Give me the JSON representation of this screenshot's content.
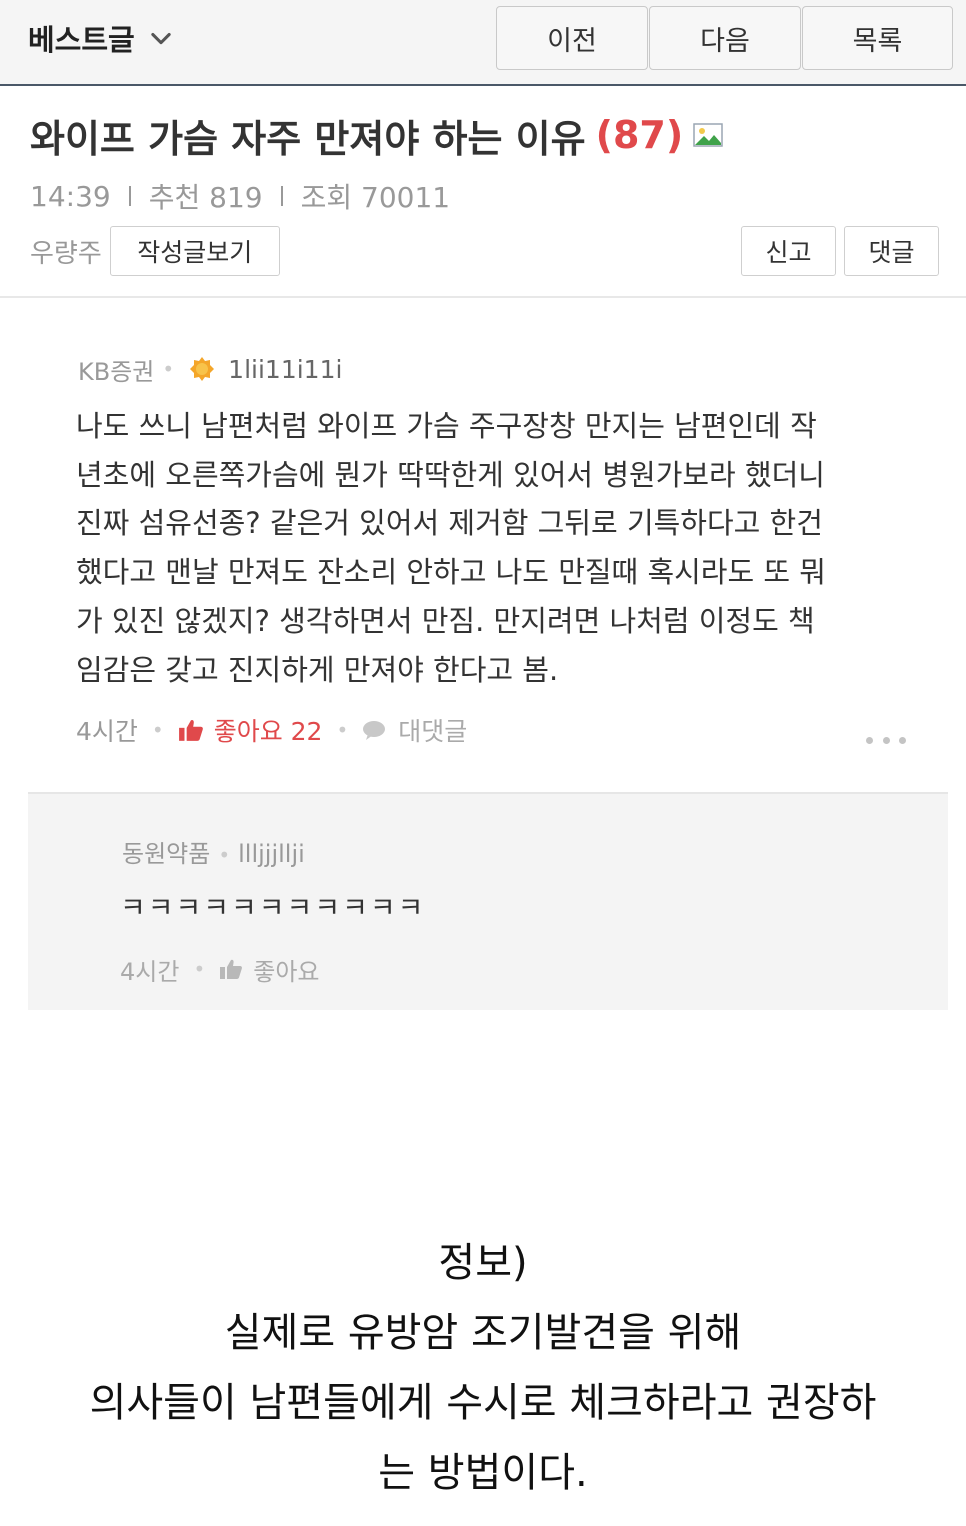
{
  "header": {
    "board_label": "베스트글",
    "prev_label": "이전",
    "next_label": "다음",
    "list_label": "목록"
  },
  "post": {
    "title": "와이프 가슴 자주 만져야 하는 이유",
    "comment_count": "(87)",
    "time": "14:39",
    "recommend": "추천 819",
    "views": "조회 70011",
    "author": "우량주",
    "view_posts_label": "작성글보기",
    "report_label": "신고",
    "comment_label": "댓글"
  },
  "comment": {
    "nickname": "KB증권",
    "user_id": "1lii11i11i",
    "lines": [
      "나도 쓰니 남편처럼 와이프 가슴 주구장창 만지는 남편인데 작",
      "년초에 오른쪽가슴에 뭔가 딱딱한게 있어서 병원가보라 했더니",
      "진짜 섬유선종? 같은거 있어서 제거함 그뒤로 기특하다고 한건",
      "했다고 맨날 만져도 잔소리 안하고 나도 만질때 혹시라도 또 뭐",
      "가 있진 않겠지? 생각하면서 만짐. 만지려면 나처럼 이정도 책",
      "임감은 갖고 진지하게 만져야 한다고 봄."
    ],
    "time": "4시간",
    "like_label": "좋아요 22",
    "reply_label": "대댓글"
  },
  "reply": {
    "nickname": "동원약품",
    "user_id": "llljjjllji",
    "text": "ㅋㅋㅋㅋㅋㅋㅋㅋㅋㅋㅋ",
    "time": "4시간",
    "like_label": "좋아요"
  },
  "caption": {
    "lines": [
      "정보)",
      "실제로 유방암 조기발견을 위해",
      "의사들이 남편들에게 수시로 체크하라고 권장하",
      "는 방법이다."
    ]
  },
  "colors": {
    "accent_red": "#e0494b",
    "header_border": "#4a5868"
  }
}
